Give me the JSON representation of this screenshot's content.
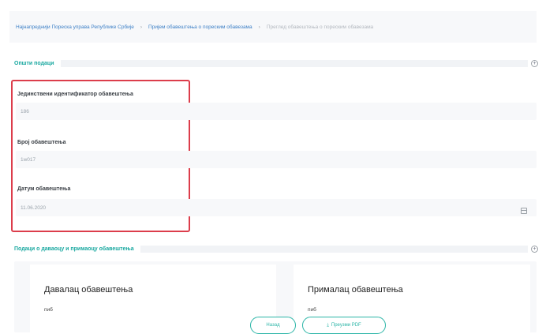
{
  "breadcrumb": [
    "Најнапреднији Пореска управа Републике Србије",
    "Пријем обавештења о пореским обавезама",
    "Преглед обавештења о пореским обавезама"
  ],
  "sections": {
    "basic_data": "Општи подаци",
    "parties": "Подаци о даваоцу и примаоцу обавештења"
  },
  "fields": {
    "id_label": "Јединствени идентификатор обавештења",
    "id_value": "186",
    "number_label": "Број обавештења",
    "number_value": "1w017",
    "date_label": "Датум обавештења",
    "date_value": "11.06.2020"
  },
  "parties": {
    "sender_title": "Давалац обавештења",
    "sender_sub": "пиб",
    "receiver_title": "Прималац обавештења",
    "receiver_sub": "пиб"
  },
  "buttons": {
    "back": "Назад",
    "download_pdf": "Преузми PDF"
  },
  "icons": {
    "section_toggle": "plus-circle-icon",
    "calendar": "calendar-icon",
    "download": "download-icon"
  },
  "colors": {
    "accent": "#2bb5a7",
    "highlight_border": "#dc3d4b",
    "link": "#3c7fc6"
  }
}
